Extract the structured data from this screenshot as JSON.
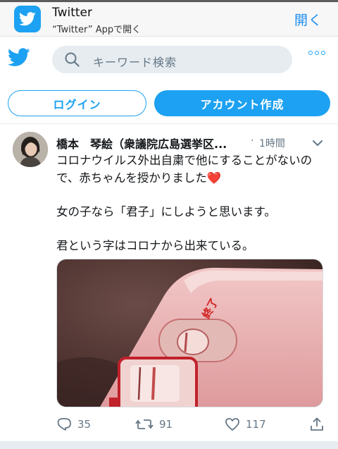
{
  "banner": {
    "title": "Twitter",
    "subtitle": "“Twitter” Appで開く",
    "open_label": "開く",
    "icon": "twitter-bird-icon"
  },
  "header": {
    "logo_icon": "twitter-bird-icon",
    "search_placeholder": "キーワード検索",
    "more_icon": "more-dots-icon"
  },
  "auth": {
    "login_label": "ログイン",
    "signup_label": "アカウント作成"
  },
  "tweet": {
    "author": "橋本　琴絵（衆議院広島選挙区...",
    "time": "1時間",
    "dot": "·",
    "paragraphs": [
      "コロナウイルス外出自粛で他にすることがないので、赤ちゃんを授かりました❤️",
      "女の子なら「君子」にしようと思います。",
      "君という字はコロナから出来ている。"
    ],
    "photo_label": "終了",
    "replies": "35",
    "retweets": "91",
    "likes": "117"
  },
  "colors": {
    "accent": "#1da1f2",
    "muted": "#657786",
    "search_bg": "#e6ecf0"
  }
}
